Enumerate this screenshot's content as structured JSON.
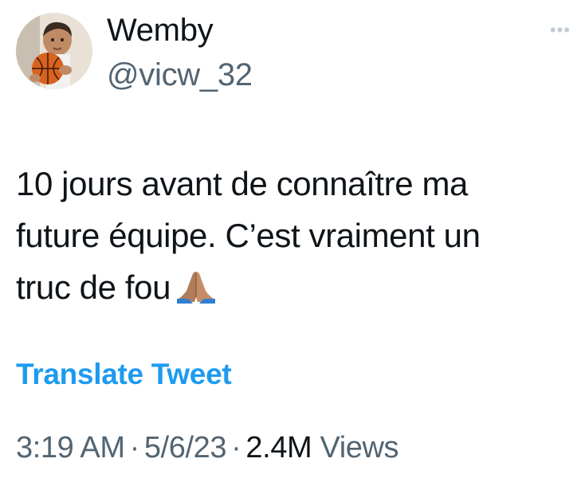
{
  "author": {
    "display_name": "Wemby",
    "handle": "@vicw_32",
    "avatar_icon": "child-with-basketball-avatar"
  },
  "more_icon": "more-dots-icon",
  "tweet": {
    "lines": [
      "10 jours avant de connaître ma",
      "future équipe. C’est vraiment un",
      "truc de fou"
    ],
    "emoji": "🙏🏽"
  },
  "translate_label": "Translate Tweet",
  "meta": {
    "time": "3:19 AM",
    "separator": "·",
    "date": "5/6/23",
    "views_count": "2.4M",
    "views_label": "Views"
  },
  "colors": {
    "text": "#0f1419",
    "secondary": "#536471",
    "link": "#1d9bf0"
  }
}
